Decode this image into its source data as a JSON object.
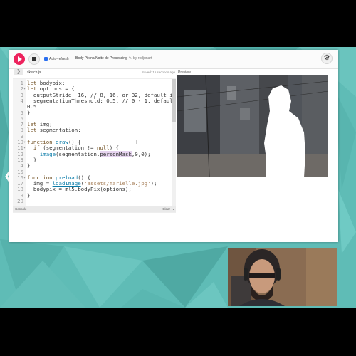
{
  "toolbar": {
    "auto_refresh_label": "Auto-refresh",
    "sketch_title": "Body Pix na Noite de Processing",
    "pencil_icon": "✎",
    "author": "by rodjunart",
    "gear_icon": "⚙"
  },
  "tabs": {
    "toggle_icon": "❯",
    "file_name": "sketch.js",
    "saved_status": "Saved: 15 seconds ago",
    "preview_label": "Preview"
  },
  "code": {
    "lines": [
      {
        "n": "1",
        "fold": ""
      },
      {
        "n": "2",
        "fold": "▾"
      },
      {
        "n": "3",
        "fold": ""
      },
      {
        "n": "4",
        "fold": ""
      },
      {
        "n": "",
        "fold": ""
      },
      {
        "n": "5",
        "fold": ""
      },
      {
        "n": "6",
        "fold": ""
      },
      {
        "n": "7",
        "fold": ""
      },
      {
        "n": "8",
        "fold": ""
      },
      {
        "n": "9",
        "fold": ""
      },
      {
        "n": "10",
        "fold": "▾"
      },
      {
        "n": "11",
        "fold": "▾"
      },
      {
        "n": "12",
        "fold": ""
      },
      {
        "n": "13",
        "fold": ""
      },
      {
        "n": "14",
        "fold": ""
      },
      {
        "n": "15",
        "fold": ""
      },
      {
        "n": "16",
        "fold": "▾"
      },
      {
        "n": "17",
        "fold": ""
      },
      {
        "n": "18",
        "fold": ""
      },
      {
        "n": "19",
        "fold": ""
      },
      {
        "n": "20",
        "fold": ""
      }
    ],
    "l1_kw": "let",
    "l1_rest": " bodypix;",
    "l2_kw": "let",
    "l2_rest": " options = {",
    "l3": "  outputStride: 16, // 8, 16, or 32, default is 16",
    "l4": "  segmentationThreshold: 0.5, // 0 - 1, defaults to",
    "l4b": "0.5",
    "l5": "}",
    "l7_kw": "let",
    "l7_rest": " img;",
    "l8_kw": "let",
    "l8_rest": " segmentation;",
    "l10_kw": "function",
    "l10_fn": " draw",
    "l10_rest": "() {",
    "l11_kw": "  if",
    "l11_rest": " (segmentation != ",
    "l11_null": "null",
    "l11_end": ") {",
    "l12_pre": "    ",
    "l12_fn": "image",
    "l12_mid": "(segmentation.",
    "l12_hl": "personMask",
    "l12_end": ",0,0);",
    "l13": "  }",
    "l14": "}",
    "l16_kw": "function",
    "l16_fn": " preload",
    "l16_rest": "() {",
    "l17_pre": "  img = ",
    "l17_fn": "loadImage",
    "l17_open": "(",
    "l17_str": "'assets/marielle.jpg'",
    "l17_end": ");",
    "l18": "  bodypix = ml5.bodyPix(options);",
    "l19": "}",
    "cursor": "I"
  },
  "console": {
    "label": "Console",
    "clear_label": "Clear",
    "chevron_icon": "⌄"
  },
  "nav": {
    "left_arrow_icon": "❮"
  },
  "colors": {
    "accent": "#ed225d",
    "stage_teal": "#5fbcb6"
  }
}
